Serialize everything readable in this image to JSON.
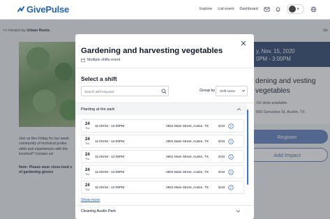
{
  "brand": {
    "name": "GivePulse",
    "color": "#2563b8"
  },
  "nav": {
    "links": [
      "Explore",
      "List event",
      "Dashboard"
    ]
  },
  "background": {
    "hosted_prefix": "<< Hosted by",
    "host_name": "Urban Roots",
    "share_partial": "Sh",
    "description": "Join us this Friday for our week community of technical profes skills and experiences with the involved? Contact us!",
    "note": "Note: Please wear close-toed s of gardening gloves",
    "sidebar": {
      "date_line1": "y, Nov. 15, 2020",
      "date_line2": "0PM - 3:00PM",
      "title": "dening and vesting vegetables",
      "slots": "/10 slots available",
      "address": "900 Gonzales St. Austin, TX",
      "register": "Register",
      "add_impact": "Add Impact"
    }
  },
  "modal": {
    "title": "Gardening and harvesting vegetables",
    "subtitle": "Multiple shifts event",
    "select_heading": "Select a shift",
    "search_placeholder": "Search with keyword",
    "group_by_label": "Group by",
    "group_by_value": "Shift name",
    "group1": "Planting at the park",
    "shifts": [
      {
        "day": "24",
        "weekday": "Thu",
        "time": "11:00AM - 12:00PM",
        "address": "2801 Main Street, Austin, TX",
        "slots": "5/10"
      },
      {
        "day": "24",
        "weekday": "Thu",
        "time": "11:00AM - 12:00PM",
        "address": "2801 Main Street, Austin, TX",
        "slots": "5/10"
      },
      {
        "day": "24",
        "weekday": "Thu",
        "time": "11:00AM - 12:00PM",
        "address": "2801 Main Street, Austin, TX",
        "slots": "5/10"
      },
      {
        "day": "24",
        "weekday": "Thu",
        "time": "11:00AM - 12:00PM",
        "address": "2801 Main Street, Austin, TX",
        "slots": "5/10"
      },
      {
        "day": "24",
        "weekday": "Thu",
        "time": "11:00AM - 12:00PM",
        "address": "2801 Main Street, Austin, TX",
        "slots": "5/10"
      }
    ],
    "show_more": "Show more",
    "group2": "Cleaning Austin Park"
  },
  "icons": {
    "logo": "givepulse-logo-icon",
    "mail": "mail-icon",
    "bell": "bell-icon",
    "globe": "globe-icon",
    "close": "close-icon",
    "calendar": "calendar-icon",
    "search": "search-icon",
    "chevron": "chevron-down-icon",
    "info": "info-icon"
  }
}
